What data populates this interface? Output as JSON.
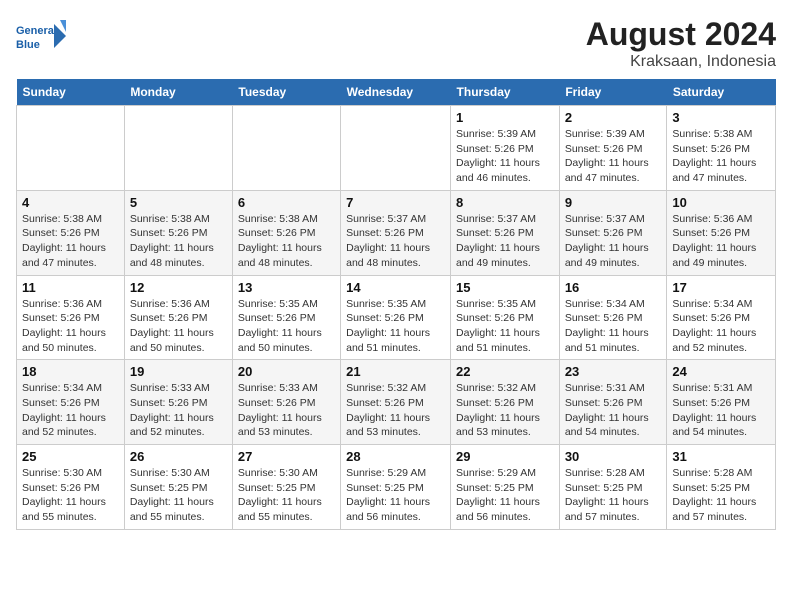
{
  "header": {
    "logo_line1": "General",
    "logo_line2": "Blue",
    "month_year": "August 2024",
    "location": "Kraksaan, Indonesia"
  },
  "weekdays": [
    "Sunday",
    "Monday",
    "Tuesday",
    "Wednesday",
    "Thursday",
    "Friday",
    "Saturday"
  ],
  "weeks": [
    [
      {
        "day": "",
        "info": ""
      },
      {
        "day": "",
        "info": ""
      },
      {
        "day": "",
        "info": ""
      },
      {
        "day": "",
        "info": ""
      },
      {
        "day": "1",
        "info": "Sunrise: 5:39 AM\nSunset: 5:26 PM\nDaylight: 11 hours and 46 minutes."
      },
      {
        "day": "2",
        "info": "Sunrise: 5:39 AM\nSunset: 5:26 PM\nDaylight: 11 hours and 47 minutes."
      },
      {
        "day": "3",
        "info": "Sunrise: 5:38 AM\nSunset: 5:26 PM\nDaylight: 11 hours and 47 minutes."
      }
    ],
    [
      {
        "day": "4",
        "info": "Sunrise: 5:38 AM\nSunset: 5:26 PM\nDaylight: 11 hours and 47 minutes."
      },
      {
        "day": "5",
        "info": "Sunrise: 5:38 AM\nSunset: 5:26 PM\nDaylight: 11 hours and 48 minutes."
      },
      {
        "day": "6",
        "info": "Sunrise: 5:38 AM\nSunset: 5:26 PM\nDaylight: 11 hours and 48 minutes."
      },
      {
        "day": "7",
        "info": "Sunrise: 5:37 AM\nSunset: 5:26 PM\nDaylight: 11 hours and 48 minutes."
      },
      {
        "day": "8",
        "info": "Sunrise: 5:37 AM\nSunset: 5:26 PM\nDaylight: 11 hours and 49 minutes."
      },
      {
        "day": "9",
        "info": "Sunrise: 5:37 AM\nSunset: 5:26 PM\nDaylight: 11 hours and 49 minutes."
      },
      {
        "day": "10",
        "info": "Sunrise: 5:36 AM\nSunset: 5:26 PM\nDaylight: 11 hours and 49 minutes."
      }
    ],
    [
      {
        "day": "11",
        "info": "Sunrise: 5:36 AM\nSunset: 5:26 PM\nDaylight: 11 hours and 50 minutes."
      },
      {
        "day": "12",
        "info": "Sunrise: 5:36 AM\nSunset: 5:26 PM\nDaylight: 11 hours and 50 minutes."
      },
      {
        "day": "13",
        "info": "Sunrise: 5:35 AM\nSunset: 5:26 PM\nDaylight: 11 hours and 50 minutes."
      },
      {
        "day": "14",
        "info": "Sunrise: 5:35 AM\nSunset: 5:26 PM\nDaylight: 11 hours and 51 minutes."
      },
      {
        "day": "15",
        "info": "Sunrise: 5:35 AM\nSunset: 5:26 PM\nDaylight: 11 hours and 51 minutes."
      },
      {
        "day": "16",
        "info": "Sunrise: 5:34 AM\nSunset: 5:26 PM\nDaylight: 11 hours and 51 minutes."
      },
      {
        "day": "17",
        "info": "Sunrise: 5:34 AM\nSunset: 5:26 PM\nDaylight: 11 hours and 52 minutes."
      }
    ],
    [
      {
        "day": "18",
        "info": "Sunrise: 5:34 AM\nSunset: 5:26 PM\nDaylight: 11 hours and 52 minutes."
      },
      {
        "day": "19",
        "info": "Sunrise: 5:33 AM\nSunset: 5:26 PM\nDaylight: 11 hours and 52 minutes."
      },
      {
        "day": "20",
        "info": "Sunrise: 5:33 AM\nSunset: 5:26 PM\nDaylight: 11 hours and 53 minutes."
      },
      {
        "day": "21",
        "info": "Sunrise: 5:32 AM\nSunset: 5:26 PM\nDaylight: 11 hours and 53 minutes."
      },
      {
        "day": "22",
        "info": "Sunrise: 5:32 AM\nSunset: 5:26 PM\nDaylight: 11 hours and 53 minutes."
      },
      {
        "day": "23",
        "info": "Sunrise: 5:31 AM\nSunset: 5:26 PM\nDaylight: 11 hours and 54 minutes."
      },
      {
        "day": "24",
        "info": "Sunrise: 5:31 AM\nSunset: 5:26 PM\nDaylight: 11 hours and 54 minutes."
      }
    ],
    [
      {
        "day": "25",
        "info": "Sunrise: 5:30 AM\nSunset: 5:26 PM\nDaylight: 11 hours and 55 minutes."
      },
      {
        "day": "26",
        "info": "Sunrise: 5:30 AM\nSunset: 5:25 PM\nDaylight: 11 hours and 55 minutes."
      },
      {
        "day": "27",
        "info": "Sunrise: 5:30 AM\nSunset: 5:25 PM\nDaylight: 11 hours and 55 minutes."
      },
      {
        "day": "28",
        "info": "Sunrise: 5:29 AM\nSunset: 5:25 PM\nDaylight: 11 hours and 56 minutes."
      },
      {
        "day": "29",
        "info": "Sunrise: 5:29 AM\nSunset: 5:25 PM\nDaylight: 11 hours and 56 minutes."
      },
      {
        "day": "30",
        "info": "Sunrise: 5:28 AM\nSunset: 5:25 PM\nDaylight: 11 hours and 57 minutes."
      },
      {
        "day": "31",
        "info": "Sunrise: 5:28 AM\nSunset: 5:25 PM\nDaylight: 11 hours and 57 minutes."
      }
    ]
  ]
}
